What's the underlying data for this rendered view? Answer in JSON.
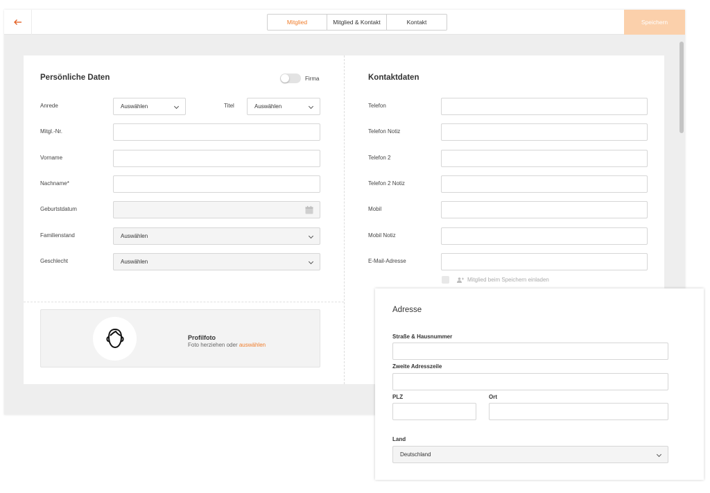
{
  "topbar": {
    "back_icon": "arrow-left-icon",
    "tabs": [
      {
        "label": "Mitglied",
        "active": true
      },
      {
        "label": "Mitglied & Kontakt",
        "active": false
      },
      {
        "label": "Kontakt",
        "active": false
      }
    ],
    "save_label": "Speichern"
  },
  "colors": {
    "accent": "#f07c2a",
    "save_bg": "#fbd0ab",
    "app_bg": "#eeeeee"
  },
  "personal": {
    "title": "Persönliche Daten",
    "firma_label": "Firma",
    "firma_on": false,
    "anrede": {
      "label": "Anrede",
      "value": "Auswählen"
    },
    "titel": {
      "label": "Titel",
      "value": "Auswählen"
    },
    "mitglnr": {
      "label": "Mitgl.-Nr.",
      "value": ""
    },
    "vorname": {
      "label": "Vorname",
      "value": ""
    },
    "nachname": {
      "label": "Nachname*",
      "value": ""
    },
    "geburtsdatum": {
      "label": "Geburtstdatum",
      "value": "",
      "icon": "calendar-icon"
    },
    "familienstand": {
      "label": "Familienstand",
      "value": "Auswählen"
    },
    "geschlecht": {
      "label": "Geschlecht",
      "value": "Auswählen"
    }
  },
  "photo": {
    "title": "Profilfoto",
    "text": "Foto herziehen oder",
    "link": "auswählen",
    "icon": "user-avatar-icon"
  },
  "contact": {
    "title": "Kontaktdaten",
    "fields": [
      {
        "label": "Telefon",
        "value": ""
      },
      {
        "label": "Telefon Notiz",
        "value": ""
      },
      {
        "label": "Telefon 2",
        "value": ""
      },
      {
        "label": "Telefon 2 Notiz",
        "value": ""
      },
      {
        "label": "Mobil",
        "value": ""
      },
      {
        "label": "Mobil Notiz",
        "value": ""
      },
      {
        "label": "E-Mail-Adresse",
        "value": ""
      }
    ],
    "invite_label": "Mitglied beim Speichern einladen",
    "invite_icon": "user-plus-icon"
  },
  "address": {
    "title": "Adresse",
    "street_label": "Straße & Hausnummer",
    "street_value": "",
    "line2_label": "Zweite Adresszeile",
    "line2_value": "",
    "plz_label": "PLZ",
    "plz_value": "",
    "ort_label": "Ort",
    "ort_value": "",
    "land_label": "Land",
    "land_value": "Deutschland"
  }
}
